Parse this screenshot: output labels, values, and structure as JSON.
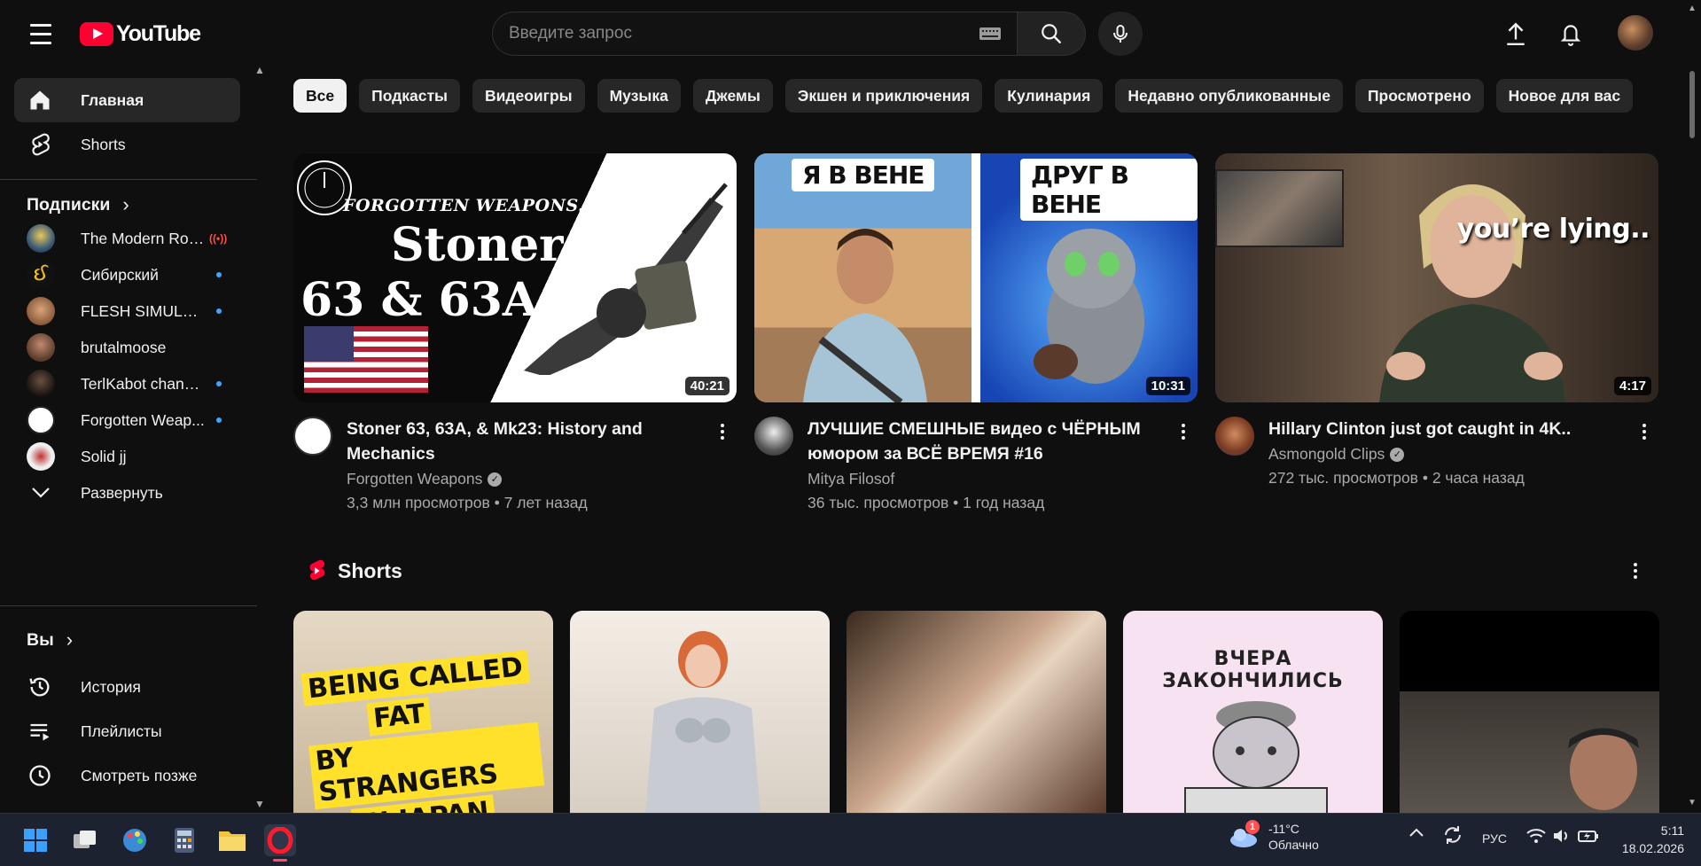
{
  "app": {
    "logo_text": "YouTube"
  },
  "search": {
    "placeholder": "Введите запрос"
  },
  "sidebar": {
    "main": [
      {
        "label": "Главная",
        "icon": "home-icon",
        "active": true
      },
      {
        "label": "Shorts",
        "icon": "shorts-icon",
        "active": false
      }
    ],
    "subscriptions_header": "Подписки",
    "subscriptions": [
      {
        "label": "The Modern Rog...",
        "status": "live"
      },
      {
        "label": "Сибирский",
        "status": "new"
      },
      {
        "label": "FLESH SIMULAT...",
        "status": "new"
      },
      {
        "label": "brutalmoose",
        "status": ""
      },
      {
        "label": "TerlKabot channel",
        "status": "new"
      },
      {
        "label": "Forgotten Weap...",
        "status": "new"
      },
      {
        "label": "Solid jj",
        "status": ""
      }
    ],
    "expand_label": "Развернуть",
    "you_header": "Вы",
    "you_items": [
      {
        "label": "История",
        "icon": "history-icon"
      },
      {
        "label": "Плейлисты",
        "icon": "playlists-icon"
      },
      {
        "label": "Смотреть позже",
        "icon": "watch-later-icon"
      }
    ]
  },
  "chips": [
    "Все",
    "Подкасты",
    "Видеоигры",
    "Музыка",
    "Джемы",
    "Экшен и приключения",
    "Кулинария",
    "Недавно опубликованные",
    "Просмотрено",
    "Новое для вас"
  ],
  "videos": [
    {
      "title": "Stoner 63, 63A, & Mk23: History and Mechanics",
      "channel": "Forgotten Weapons",
      "verified": true,
      "stats": "3,3 млн просмотров • 7 лет назад",
      "duration": "40:21",
      "thumb_text": {
        "logo": "FORGOTTEN WEAPONS.com",
        "line1": "Stoner",
        "line2": "63 & 63A"
      }
    },
    {
      "title": "ЛУЧШИЕ СМЕШНЫЕ видео с ЧЁРНЫМ юмором за ВСЁ ВРЕМЯ #16",
      "channel": "Mitya Filosof",
      "verified": false,
      "stats": "36 тыс. просмотров • 1 год назад",
      "duration": "10:31",
      "thumb_text": {
        "left": "Я В ВЕНЕ",
        "right": "ДРУГ В ВЕНЕ"
      }
    },
    {
      "title": "Hillary Clinton just got caught in 4K..",
      "channel": "Asmongold Clips",
      "verified": true,
      "stats": "272 тыс. просмотров • 2 часа назад",
      "duration": "4:17",
      "thumb_text": {
        "caption": "you’re lying.."
      }
    }
  ],
  "shorts": {
    "title": "Shorts",
    "items": [
      {
        "text_lines": [
          "BEING CALLED",
          "FAT",
          "BY STRANGERS",
          "IN JAPAN"
        ]
      },
      {
        "text_lines": []
      },
      {
        "text_lines": []
      },
      {
        "text_lines": [
          "ВЧЕРА ЗАКОНЧИЛИСЬ"
        ]
      },
      {
        "text_lines": []
      }
    ]
  },
  "taskbar": {
    "weather": {
      "badge": "1",
      "temp": "-11°C",
      "desc": "Облачно"
    },
    "lang": "РУС",
    "time": "5:11",
    "date": "18.02.2026"
  },
  "colors": {
    "brand_red": "#ff0033",
    "bg": "#0f0f0f",
    "chip": "#272727",
    "dot": "#3ea6ff"
  }
}
